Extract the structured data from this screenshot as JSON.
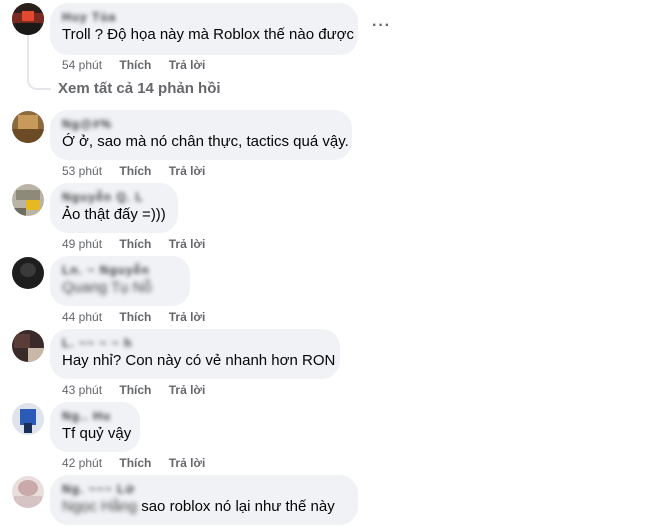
{
  "thread": {
    "view_replies_label": "Xem tất cả 14 phản hồi",
    "more_glyph": "···"
  },
  "actions": {
    "like_label": "Thích",
    "reply_label": "Trả lời"
  },
  "comments": [
    {
      "name": "Huy Tùa",
      "text": "Troll ? Độ họa này mà Roblox thế nào được",
      "time": "54 phút"
    },
    {
      "name": "Ng@#%",
      "text": "Ớ ở, sao mà nó chân thực, tactics quá vậy.",
      "time": "53 phút"
    },
    {
      "name": "Nguyễn Q. L",
      "text": "Ảo thật đấy =)))",
      "time": "49 phút"
    },
    {
      "name": "Ln. ~ Nguyễn",
      "text": "Quang Tụ Nỗ",
      "time": "44 phút"
    },
    {
      "name": "L. ~~ ~ ~ h",
      "text": "Hay nhỉ? Con này có vẻ nhanh hơn RON",
      "time": "43 phút"
    },
    {
      "name": "Ng.. Hu",
      "text": "Tf quỷ vậy",
      "time": "42 phút"
    },
    {
      "name": "Ng. ~~~ Lử",
      "text_prefix": "Ngọc Hằng",
      "text": "sao roblox nó lại như thế này",
      "time": ""
    }
  ],
  "colors": {
    "bubble_bg": "#f0f2f5",
    "meta_text": "#65676b",
    "thread_line": "#e4e6eb"
  }
}
